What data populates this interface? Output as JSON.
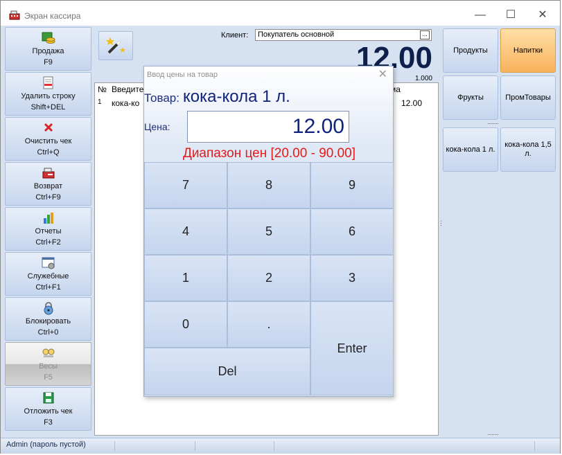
{
  "window": {
    "title": "Экран кассира",
    "minimize": "—",
    "maximize": "☐",
    "close": "✕"
  },
  "sidebar": {
    "items": [
      {
        "label": "Продажа",
        "shortcut": "F9",
        "icon": "coins-icon"
      },
      {
        "label": "Удалить строку",
        "shortcut": "Shift+DEL",
        "icon": "delete-line-icon"
      },
      {
        "label": "Очистить чек",
        "shortcut": "Ctrl+Q",
        "icon": "red-x-icon"
      },
      {
        "label": "Возврат",
        "shortcut": "Ctrl+F9",
        "icon": "return-icon"
      },
      {
        "label": "Отчеты",
        "shortcut": "Ctrl+F2",
        "icon": "bar-chart-icon"
      },
      {
        "label": "Служебные",
        "shortcut": "Ctrl+F1",
        "icon": "settings-window-icon"
      },
      {
        "label": "Блокировать",
        "shortcut": "Ctrl+0",
        "icon": "lock-icon"
      },
      {
        "label": "Весы",
        "shortcut": "F5",
        "icon": "scales-icon"
      },
      {
        "label": "Отложить чек",
        "shortcut": "F3",
        "icon": "floppy-icon"
      }
    ]
  },
  "client": {
    "label": "Клиент:",
    "value": "Покупатель основной",
    "browse": "..."
  },
  "total": {
    "amount": "12.00",
    "sub": "1.000"
  },
  "receipt": {
    "headers": [
      "№",
      "Введите",
      "ма"
    ],
    "rows": [
      {
        "num": "1",
        "name": "кока-ко",
        "sum": "12.00"
      }
    ]
  },
  "categories": [
    {
      "label": "Продукты"
    },
    {
      "label": "Напитки"
    },
    {
      "label": "Фрукты"
    },
    {
      "label": "ПромТовары"
    }
  ],
  "products": [
    {
      "label": "кока-кола 1 л."
    },
    {
      "label": "кока-кола 1,5 л."
    }
  ],
  "status": {
    "user": "Admin (пароль пустой)"
  },
  "modal": {
    "title": "Ввод цены на товар",
    "close": "✕",
    "goods_label": "Товар:",
    "goods_name": "кока-кола 1 л.",
    "price_label": "Цена:",
    "price_value": "12.00",
    "range": "Диапазон цен [20.00 - 90.00]",
    "keys": [
      "7",
      "8",
      "9",
      "4",
      "5",
      "6",
      "1",
      "2",
      "3",
      "0",
      ".",
      "Enter",
      "Del"
    ]
  },
  "colors": {
    "accent_orange": "#f9b25a",
    "price_range_red": "#e21a1a",
    "total_navy": "#0d1f4a"
  }
}
